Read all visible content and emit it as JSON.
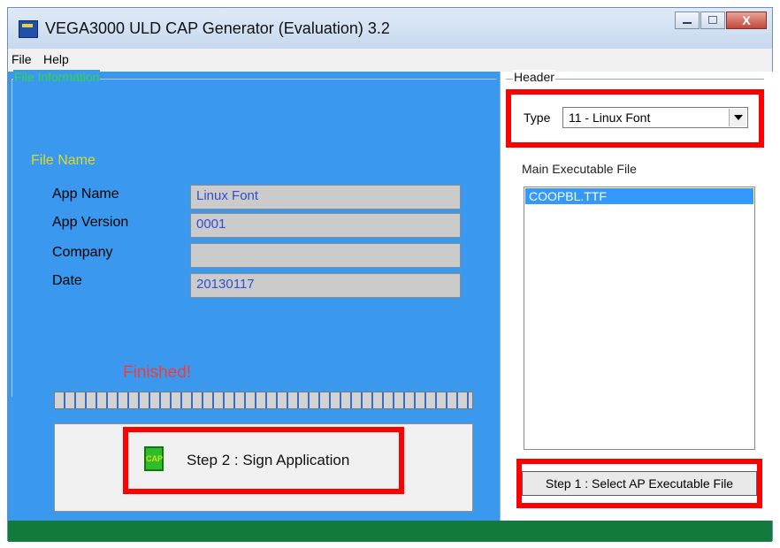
{
  "window": {
    "title": "VEGA3000 ULD CAP Generator (Evaluation) 3.2",
    "close_glyph": "X"
  },
  "menu": {
    "items": [
      {
        "label": "File"
      },
      {
        "label": "Help"
      }
    ]
  },
  "file_info": {
    "legend": "File Information",
    "file_name_label": "File Name",
    "fields": [
      {
        "label": "App Name",
        "value": "Linux Font"
      },
      {
        "label": "App Version",
        "value": "0001"
      },
      {
        "label": "Company",
        "value": ""
      },
      {
        "label": "Date",
        "value": "20130117"
      }
    ],
    "status": "Finished!",
    "progress": 1.0,
    "sign_button": {
      "label": "Step 2 : Sign Application",
      "icon": "cap-icon",
      "icon_text": "CAP"
    }
  },
  "header": {
    "legend": "Header",
    "type_label": "Type",
    "type_value": "11 - Linux Font",
    "main_exe_label": "Main Executable File",
    "files": [
      "COOPBL.TTF"
    ],
    "select_button_label": "Step 1 : Select AP Executable File"
  },
  "colors": {
    "left_panel": "#3a99ef",
    "highlight": "#ff0000",
    "statusbar": "#127a3a",
    "selected_row": "#3399ff"
  }
}
